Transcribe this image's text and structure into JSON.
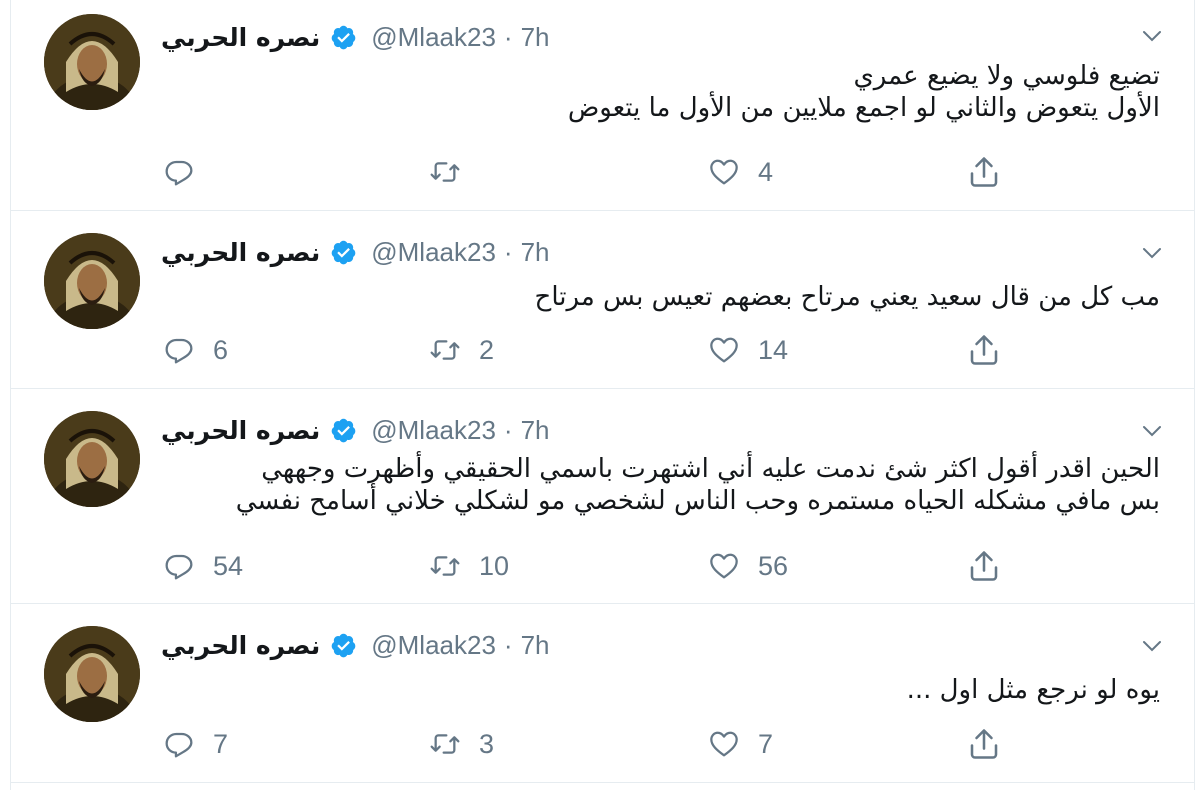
{
  "tweets": [
    {
      "name": "نصره الحربي",
      "handle": "@Mlaak23",
      "separator": "·",
      "time": "7h",
      "lines": [
        "تضيع فلوسي ولا يضيع عمري",
        "الأول يتعوض والثاني لو اجمع ملايين من الأول ما يتعوض"
      ],
      "replies": "",
      "retweets": "",
      "likes": "4"
    },
    {
      "name": "نصره الحربي",
      "handle": "@Mlaak23",
      "separator": "·",
      "time": "7h",
      "lines": [
        "مب كل من قال سعيد يعني مرتاح بعضهم تعيس بس مرتاح"
      ],
      "replies": "6",
      "retweets": "2",
      "likes": "14"
    },
    {
      "name": "نصره الحربي",
      "handle": "@Mlaak23",
      "separator": "·",
      "time": "7h",
      "lines": [
        "الحين اقدر أقول اكثر شئ ندمت عليه أني اشتهرت باسمي الحقيقي وأظهرت وجههي",
        "بس مافي مشكله الحياه مستمره وحب الناس لشخصي مو لشكلي خلاني أسامح نفسي"
      ],
      "replies": "54",
      "retweets": "10",
      "likes": "56"
    },
    {
      "name": "نصره الحربي",
      "handle": "@Mlaak23",
      "separator": "·",
      "time": "7h",
      "lines": [
        "يوه لو نرجع مثل اول ..."
      ],
      "replies": "7",
      "retweets": "3",
      "likes": "7"
    }
  ],
  "icons": {
    "reply": "reply-icon",
    "retweet": "retweet-icon",
    "like": "heart-icon",
    "share": "share-icon",
    "verified": "verified-badge-icon",
    "menu": "chevron-down-icon"
  },
  "colors": {
    "text": "#14171a",
    "secondary": "#657786",
    "verified": "#1da1f2",
    "border": "#e6ecf0"
  }
}
